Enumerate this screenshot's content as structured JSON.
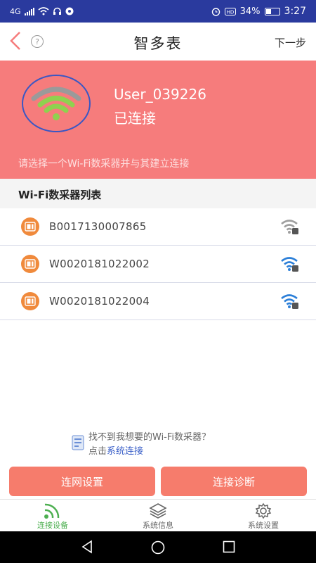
{
  "status_bar": {
    "network": "4G",
    "battery": "34%",
    "time": "3:27"
  },
  "header": {
    "title": "智多表",
    "next_label": "下一步",
    "help_glyph": "?"
  },
  "banner": {
    "user": "User_039226",
    "status": "已连接",
    "hint": "请选择一个Wi-Fi数采器并与其建立连接"
  },
  "list": {
    "title": "Wi-Fi数采器列表",
    "devices": [
      {
        "id": "B0017130007865",
        "signal_color": "#9e9e9e"
      },
      {
        "id": "W0020181022002",
        "signal_color": "#2c7fd8"
      },
      {
        "id": "W0020181022004",
        "signal_color": "#2c7fd8"
      }
    ]
  },
  "prompt": {
    "line1": "找不到我想要的Wi-Fi数采器？",
    "line2_prefix": "点击",
    "line2_link": "系统连接"
  },
  "buttons": {
    "network_settings": "连网设置",
    "diagnose": "连接诊断"
  },
  "tabs": {
    "connect": "连接设备",
    "info": "系统信息",
    "settings": "系统设置"
  },
  "colors": {
    "accent": "#f67c7c",
    "status_bar": "#2a3a9e",
    "active_tab": "#4caf50",
    "link": "#3a5fc8"
  }
}
